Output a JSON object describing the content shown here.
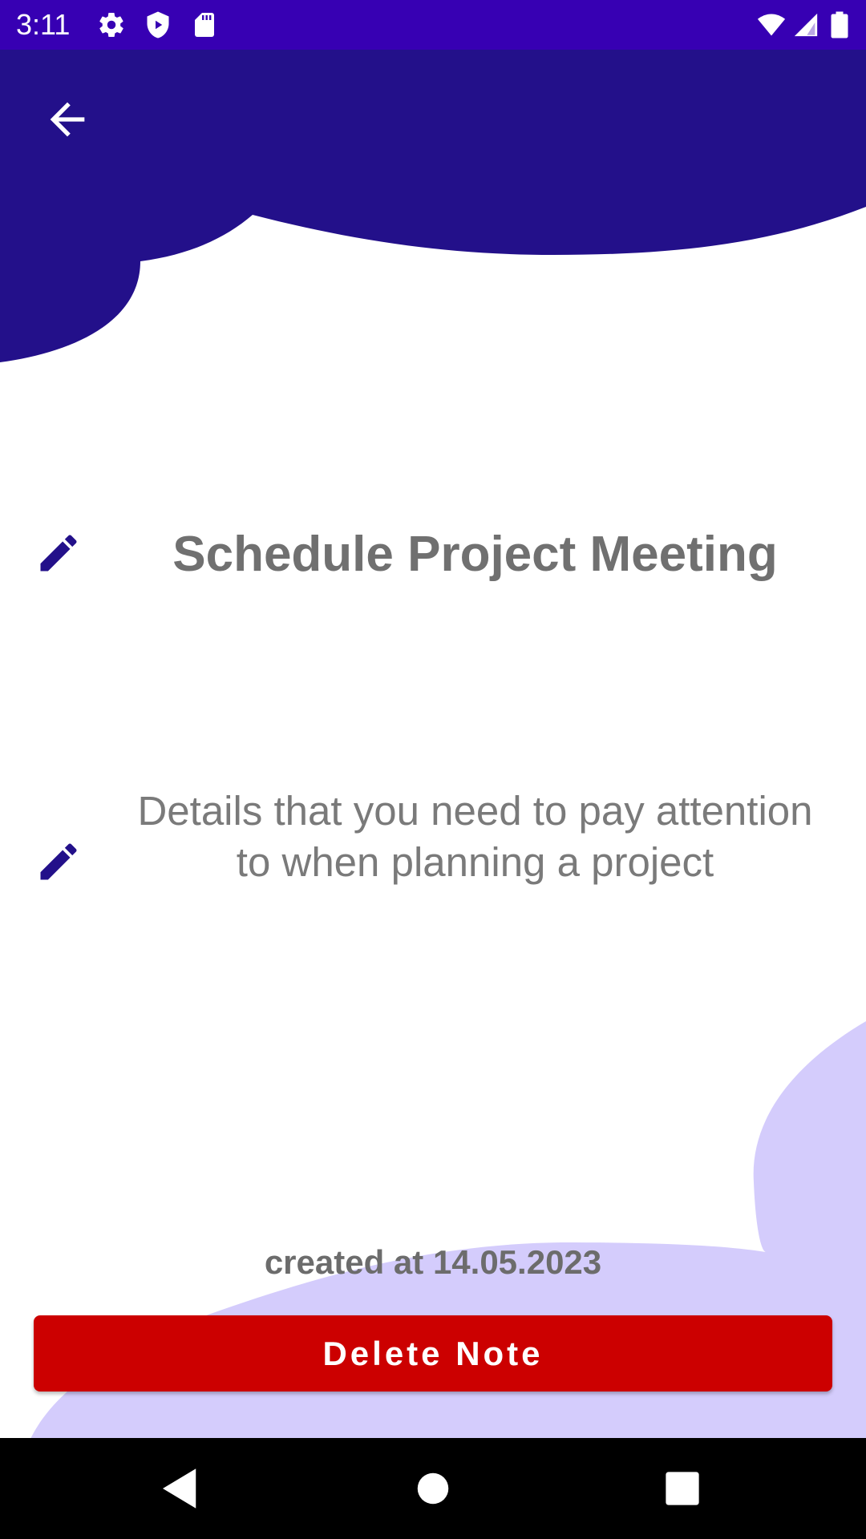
{
  "status_bar": {
    "time": "3:11",
    "background": "#3700b3",
    "left_icons": [
      "settings-icon",
      "shield-icon",
      "sd-card-icon"
    ],
    "right_icons": [
      "wifi-icon",
      "cellular-signal-icon",
      "battery-icon"
    ]
  },
  "header": {
    "color": "#23108a",
    "back_icon": "arrow-back-icon"
  },
  "note": {
    "title": "Schedule Project Meeting",
    "details": "Details that you need to pay attention to when planning a project",
    "edit_icon": "pencil-icon",
    "created_label": "created at ",
    "created_date": "14.05.2023"
  },
  "actions": {
    "delete_label": "Delete Note",
    "delete_color": "#cc0000"
  },
  "decoration": {
    "bottom_blob_color": "#d4ccfc"
  },
  "nav_bar": {
    "icons": [
      "nav-back-icon",
      "nav-home-icon",
      "nav-recents-icon"
    ]
  }
}
